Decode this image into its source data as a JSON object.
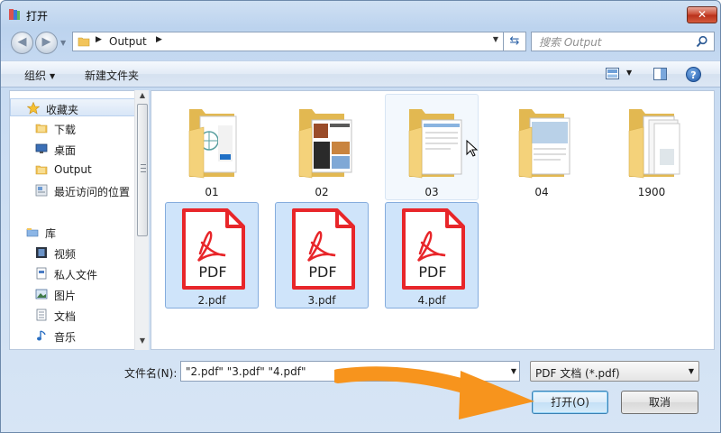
{
  "window": {
    "title": "打开",
    "close_symbol": "✕"
  },
  "address": {
    "crumbs": [
      "Output"
    ],
    "search_placeholder": "搜索 Output"
  },
  "toolbar": {
    "organize": "组织",
    "new_folder": "新建文件夹"
  },
  "nav": {
    "favorites_label": "收藏夹",
    "favorites": [
      {
        "label": "下载",
        "icon": "folder-icon"
      },
      {
        "label": "桌面",
        "icon": "desktop-icon"
      },
      {
        "label": "Output",
        "icon": "folder-icon"
      },
      {
        "label": "最近访问的位置",
        "icon": "recent-places-icon"
      }
    ],
    "libraries_label": "库",
    "libraries": [
      {
        "label": "视频",
        "icon": "video-icon"
      },
      {
        "label": "私人文件",
        "icon": "document-icon"
      },
      {
        "label": "图片",
        "icon": "pictures-icon"
      },
      {
        "label": "文档",
        "icon": "documents-icon"
      },
      {
        "label": "音乐",
        "icon": "music-icon"
      }
    ]
  },
  "files": [
    {
      "label": "01",
      "type": "folder",
      "state": "normal"
    },
    {
      "label": "02",
      "type": "folder",
      "state": "normal"
    },
    {
      "label": "03",
      "type": "folder",
      "state": "hovered"
    },
    {
      "label": "04",
      "type": "folder",
      "state": "normal"
    },
    {
      "label": "1900",
      "type": "folder",
      "state": "normal"
    },
    {
      "label": "2.pdf",
      "type": "pdf",
      "state": "selected"
    },
    {
      "label": "3.pdf",
      "type": "pdf",
      "state": "selected"
    },
    {
      "label": "4.pdf",
      "type": "pdf",
      "state": "selected"
    }
  ],
  "pdf_badge": "PDF",
  "bottom": {
    "filename_label": "文件名(N):",
    "filename_value": "\"2.pdf\" \"3.pdf\" \"4.pdf\"",
    "filetype_value": "PDF 文档 (*.pdf)",
    "open_button": "打开(O)",
    "cancel_button": "取消"
  },
  "colors": {
    "accent_arrow": "#f7941d",
    "pdf_red": "#e8262a",
    "folder_yellow": "#f4d27a"
  }
}
